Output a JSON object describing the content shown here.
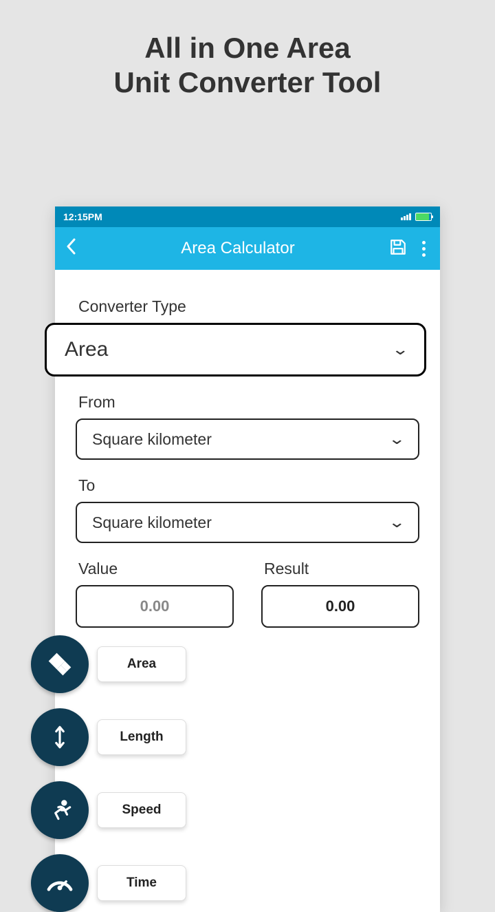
{
  "promo": {
    "line1": "All in One Area",
    "line2": "Unit Converter Tool"
  },
  "status": {
    "time": "12:15PM"
  },
  "appbar": {
    "title": "Area Calculator"
  },
  "form": {
    "converter_label": "Converter Type",
    "converter_value": "Area",
    "from_label": "From",
    "from_value": "Square kilometer",
    "to_label": "To",
    "to_value": "Square kilometer",
    "value_label": "Value",
    "value_placeholder": "0.00",
    "result_label": "Result",
    "result_value": "0.00"
  },
  "callouts": [
    {
      "label": "Area"
    },
    {
      "label": "Length"
    },
    {
      "label": "Speed"
    },
    {
      "label": "Time"
    }
  ]
}
